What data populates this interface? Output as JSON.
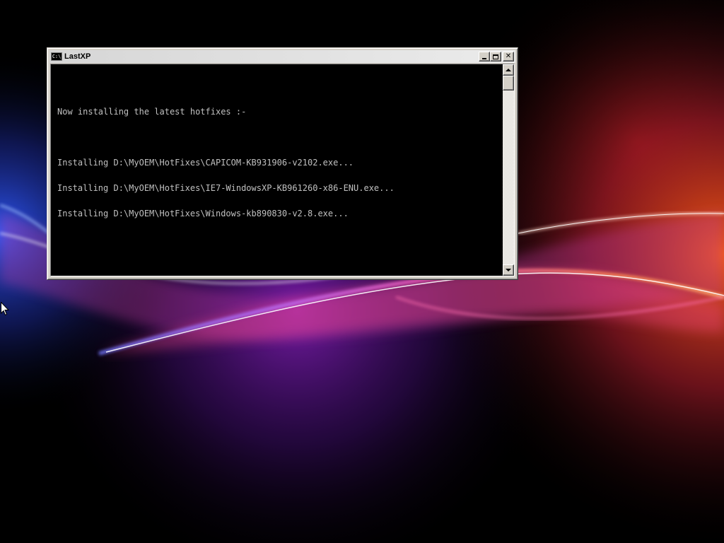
{
  "window": {
    "title": "LastXP",
    "icon_name": "console-icon",
    "icon_glyph": "C:\\",
    "minimize_icon": "minimize-icon",
    "maximize_icon": "maximize-icon",
    "close_icon": "close-icon",
    "close_glyph": "✕"
  },
  "console": {
    "background": "#000000",
    "text_color": "#c0c0c0",
    "header": "Now installing the latest hotfixes :-",
    "lines": [
      "Installing D:\\MyOEM\\HotFixes\\CAPICOM-KB931906-v2102.exe...",
      "Installing D:\\MyOEM\\HotFixes\\IE7-WindowsXP-KB961260-x86-ENU.exe...",
      "Installing D:\\MyOEM\\HotFixes\\Windows-kb890830-v2.8.exe..."
    ]
  },
  "scrollbar": {
    "up_icon": "scroll-up-arrow-icon",
    "down_icon": "scroll-down-arrow-icon",
    "position": 0
  },
  "desktop": {
    "wallpaper": "abstract-light-swoosh",
    "colors": {
      "blue": "#3a6cff",
      "purple": "#9b3cd6",
      "magenta": "#e0307a",
      "orange": "#ff6a1a"
    },
    "cursor_icon": "arrow-cursor-icon"
  }
}
